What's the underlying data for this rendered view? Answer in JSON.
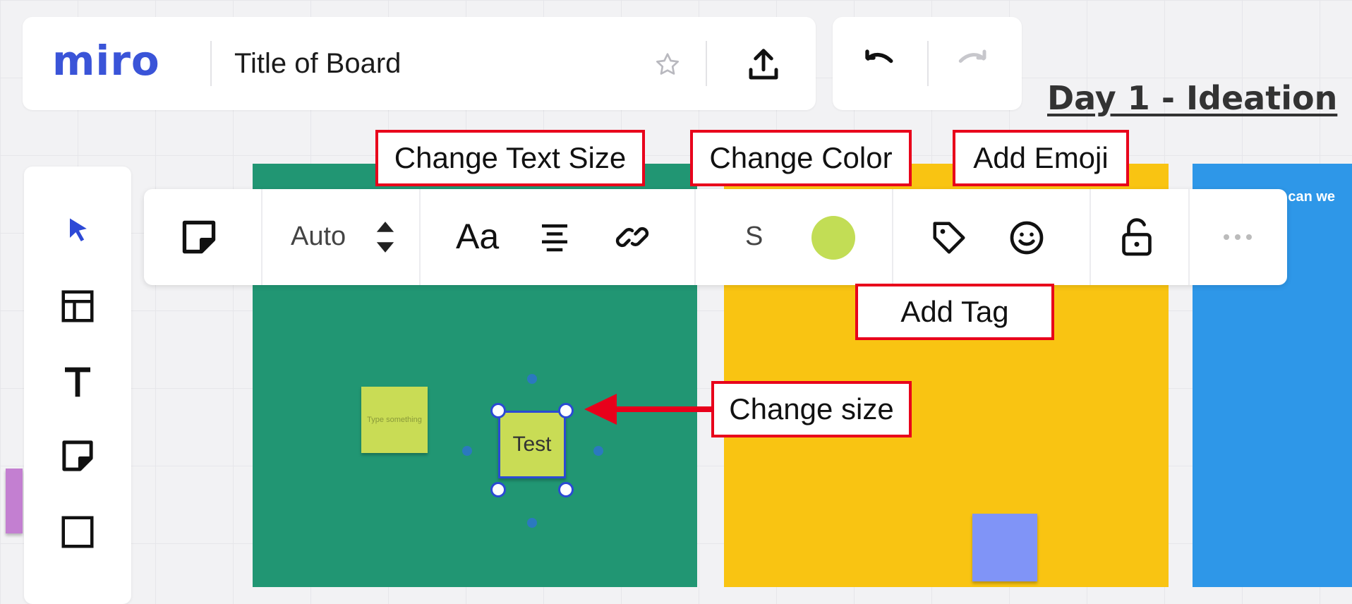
{
  "header": {
    "logo": "miro",
    "board_title": "Title of Board",
    "star_icon": "star-icon",
    "share_icon": "upload-icon"
  },
  "history": {
    "undo_icon": "undo-icon",
    "redo_icon": "redo-icon"
  },
  "board": {
    "heading": "Day 1 - Ideation",
    "blue_frame_text": "ow can we",
    "small_sticky_text": "Type something",
    "selected_sticky_text": "Test"
  },
  "left_toolbar": {
    "items": [
      {
        "icon": "select-arrow-icon"
      },
      {
        "icon": "templates-icon"
      },
      {
        "icon": "text-icon"
      },
      {
        "icon": "sticky-note-icon"
      },
      {
        "icon": "shape-icon"
      }
    ]
  },
  "context_toolbar": {
    "sticky_type_icon": "sticky-note-icon",
    "font_size_value": "Auto",
    "text_style_label": "Aa",
    "size_label": "S",
    "color": "#c2dd55",
    "icons": [
      "align-center-icon",
      "link-icon",
      "tag-icon",
      "emoji-icon",
      "unlock-icon",
      "more-icon"
    ]
  },
  "callouts": {
    "text_size": "Change Text Size",
    "color": "Change Color",
    "emoji": "Add Emoji",
    "tag": "Add Tag",
    "size": "Change size"
  },
  "colors": {
    "accent": "#3a54d8",
    "callout_border": "#e8001b",
    "frame_green": "#219673",
    "frame_yellow": "#f9c412",
    "frame_blue": "#2e97e8",
    "sticky_lime": "#c9dc55",
    "sticky_periwinkle": "#8094f7",
    "sticky_purple": "#c37fd1"
  }
}
